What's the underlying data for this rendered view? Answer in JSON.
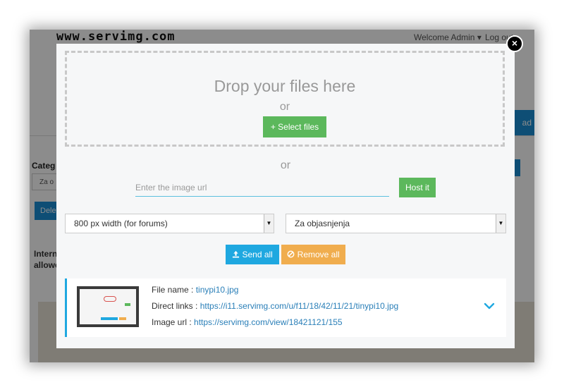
{
  "background": {
    "logo": "www.servimg.com",
    "welcome": "Welcome Admin ▾",
    "logout": "Log out",
    "upload_btn_partial": "ad",
    "category_label": "Categ",
    "category_select": "Za o",
    "delete_btn": "Dele",
    "internet_label_1": "Intern",
    "internet_label_2": "allowe"
  },
  "modal": {
    "drop_title": "Drop your files here",
    "drop_or": "or",
    "select_files_label": "+ Select files",
    "mid_or": "or",
    "url_placeholder": "Enter the image url",
    "host_label": "Host it",
    "size_select": "800 px width (for forums)",
    "category_select": "Za objasnjenja",
    "send_all_label": "Send all",
    "remove_all_label": "Remove all",
    "close_label": "×"
  },
  "file": {
    "name_label": "File name : ",
    "name_value": "tinypi10.jpg",
    "direct_label": "Direct links : ",
    "direct_value": "https://i11.servimg.com/u/f11/18/42/11/21/tinypi10.jpg",
    "image_url_label": "Image url : ",
    "image_url_value": "https://servimg.com/view/18421121/155"
  },
  "colors": {
    "green": "#5cb85c",
    "blue": "#1fa8e0",
    "orange": "#f0ad4e"
  },
  "icons": {
    "plus": "plus-icon",
    "upload": "upload-icon",
    "remove": "ban-icon",
    "chevron": "chevron-down-icon",
    "close": "close-icon"
  }
}
